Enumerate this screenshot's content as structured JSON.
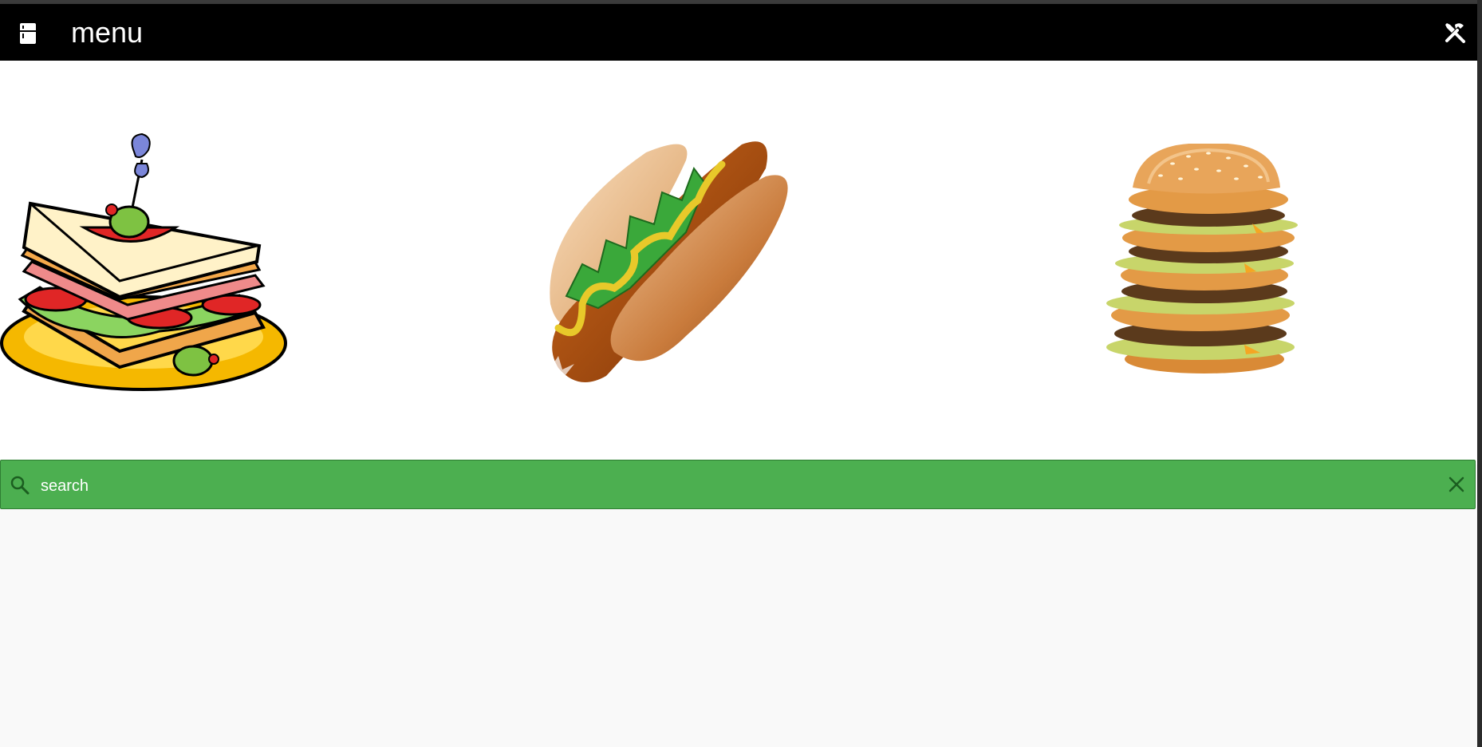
{
  "toolbar": {
    "title": "menu",
    "menu_icon": "fridge-icon",
    "tools_icon": "tools-icon"
  },
  "foods": [
    {
      "name": "sandwich",
      "icon": "sandwich-image"
    },
    {
      "name": "hot dog",
      "icon": "hotdog-image"
    },
    {
      "name": "burger",
      "icon": "burger-image"
    }
  ],
  "search": {
    "placeholder": "search",
    "value": "",
    "icon": "search-icon",
    "clear_icon": "close-icon"
  },
  "colors": {
    "toolbar_bg": "#000000",
    "search_bg": "#4caf50",
    "page_bg": "#f9f9f9",
    "content_bg": "#ffffff"
  }
}
